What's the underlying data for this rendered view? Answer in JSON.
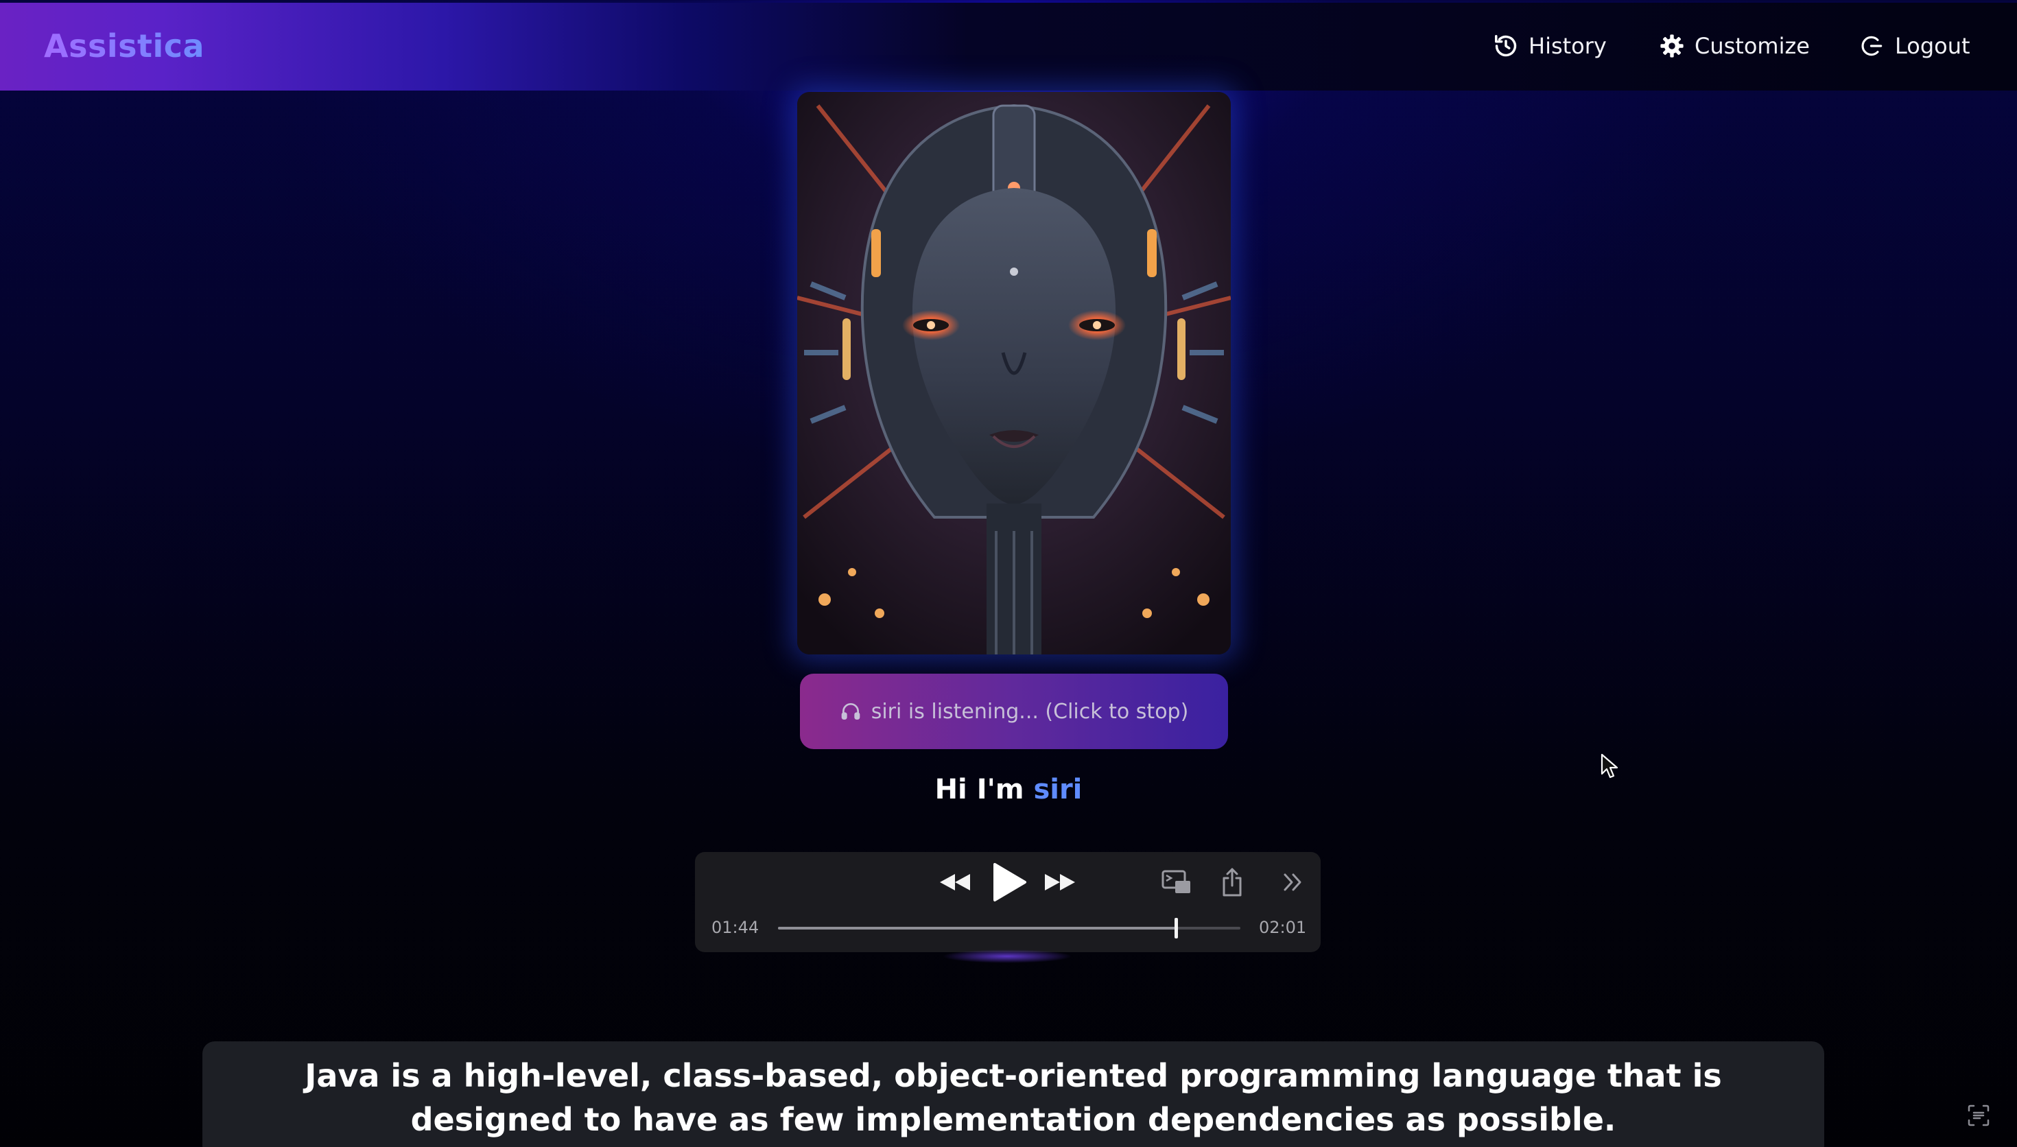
{
  "header": {
    "brand": "Assistica",
    "nav": [
      {
        "label": "History",
        "icon": "history-icon"
      },
      {
        "label": "Customize",
        "icon": "gear-icon"
      },
      {
        "label": "Logout",
        "icon": "logout-icon"
      }
    ]
  },
  "assistant": {
    "portrait_icon": "robot-face-portrait",
    "listen_button_label": "siri is listening... (Click to stop)",
    "listen_icon": "headphones-icon",
    "greeting_prefix": "Hi I'm ",
    "greeting_name": "siri"
  },
  "player": {
    "elapsed": "01:44",
    "duration": "02:01",
    "progress": 0.86,
    "controls": [
      "rewind-icon",
      "play-icon",
      "fast-forward-icon",
      "picture-in-picture-icon",
      "share-icon",
      "more-icon"
    ]
  },
  "caption": {
    "text": "Java is a high-level, class-based, object-oriented programming language that is designed to have as few implementation dependencies as possible."
  },
  "colors": {
    "accent_name": "#5f8cff",
    "brand_gradient_start": "#a06cff",
    "brand_gradient_end": "#6f8cff",
    "listen_gradient_start": "#8b2a8d",
    "listen_gradient_end": "#3a21a0"
  }
}
